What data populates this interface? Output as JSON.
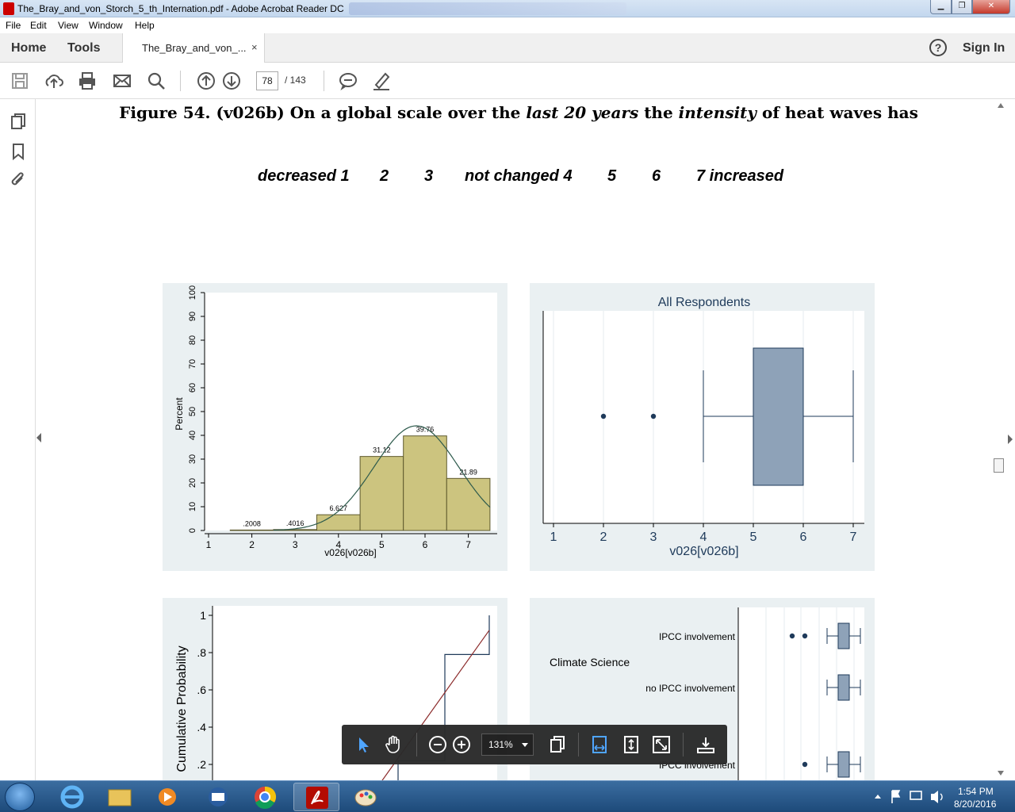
{
  "window": {
    "title": "The_Bray_and_von_Storch_5_th_Internation.pdf - Adobe Acrobat Reader DC"
  },
  "menu": [
    "File",
    "Edit",
    "View",
    "Window",
    "Help"
  ],
  "tabs": {
    "home": "Home",
    "tools": "Tools",
    "document": "The_Bray_and_von_...",
    "close_glyph": "×"
  },
  "header": {
    "help": "?",
    "sign_in": "Sign In"
  },
  "toolbar": {
    "page": "78",
    "total": "/ 143"
  },
  "figure": {
    "title_prefix": "Figure 54. (v026b) On a global scale over the ",
    "title_em1": "last 20 years",
    "title_mid": " the ",
    "title_em2": "intensity",
    "title_suffix": " of heat waves has",
    "scale": [
      "decreased  1",
      "2",
      "3",
      "not changed  4",
      "5",
      "6",
      "7 increased"
    ]
  },
  "chart_data": [
    {
      "type": "bar",
      "subtype": "histogram",
      "categories": [
        "1",
        "2",
        "3",
        "4",
        "5",
        "6",
        "7"
      ],
      "values": [
        0,
        0.2008,
        0.4016,
        6.627,
        31.12,
        39.76,
        21.89
      ],
      "labels": [
        "",
        ".2008",
        ".4016",
        "6.627",
        "31.12",
        "39.76",
        "21.89"
      ],
      "xlabel": "v026[v026b]",
      "ylabel": "Percent",
      "ylim": [
        0,
        100
      ],
      "yticks": [
        "0",
        "10",
        "20",
        "30",
        "40",
        "50",
        "60",
        "70",
        "80",
        "90",
        "100"
      ],
      "xticks": [
        "1",
        "2",
        "3",
        "4",
        "5",
        "6",
        "7"
      ],
      "overlay": "normal curve"
    },
    {
      "type": "boxplot",
      "title": "All Respondents",
      "xlabel": "v026[v026b]",
      "xticks": [
        "1",
        "2",
        "3",
        "4",
        "5",
        "6",
        "7"
      ],
      "box": {
        "whisker_low": 4,
        "q1": 5,
        "q3": 6,
        "whisker_high": 7
      },
      "outliers": [
        2,
        3
      ],
      "color": "#8ea2b8"
    },
    {
      "type": "line",
      "subtype": "cumulative distribution",
      "ylabel": "Cumulative Probability",
      "yticks": [
        ".2",
        ".4",
        ".6",
        ".8",
        "1"
      ],
      "step_color": "#1f3a5a",
      "fit_color": "#8b2a2a"
    },
    {
      "type": "boxplot",
      "group": "Climate Science",
      "series": [
        {
          "name": "IPCC involvement",
          "whisker_low": 5,
          "q1": 5.35,
          "q3": 5.7,
          "whisker_high": 6.05,
          "outliers": [
            3.9,
            4.3
          ]
        },
        {
          "name": "no IPCC involvement",
          "whisker_low": 5,
          "q1": 5.35,
          "q3": 5.7,
          "whisker_high": 6.05,
          "outliers": []
        },
        {
          "name": "IPCC involvement",
          "whisker_low": 5,
          "q1": 5.35,
          "q3": 5.7,
          "whisker_high": 6.05,
          "outliers": [
            4.3
          ]
        }
      ]
    }
  ],
  "floating_toolbar": {
    "zoom": "131%"
  },
  "taskbar": {
    "time": "1:54 PM",
    "date": "8/20/2016"
  }
}
